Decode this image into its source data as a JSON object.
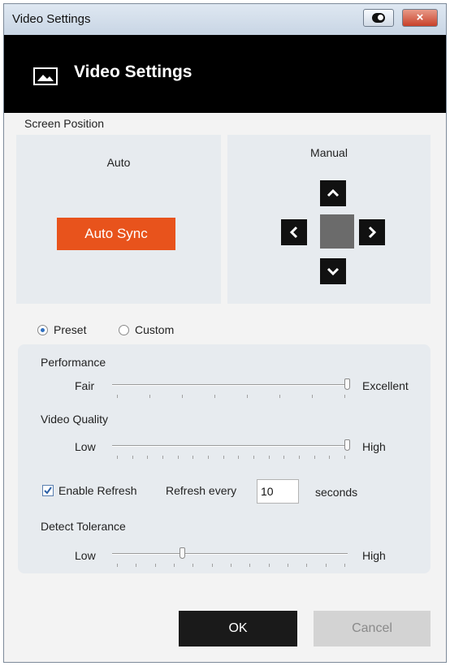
{
  "window": {
    "title": "Video Settings",
    "close_glyph": "×",
    "toggle_icon": "mode-toggle-icon"
  },
  "header": {
    "title": "Video Settings",
    "icon": "image-icon"
  },
  "screen_position": {
    "label": "Screen Position",
    "auto": {
      "title": "Auto",
      "button": "Auto Sync",
      "button_color": "#e8531c"
    },
    "manual": {
      "title": "Manual"
    }
  },
  "mode": {
    "selected": "Preset",
    "options": [
      "Preset",
      "Custom"
    ]
  },
  "performance": {
    "label": "Performance",
    "min": "Fair",
    "max": "Excellent",
    "level": 1.0
  },
  "video_quality": {
    "label": "Video Quality",
    "min": "Low",
    "max": "High",
    "level": 1.0
  },
  "refresh": {
    "checkbox_label": "Enable Refresh",
    "checked": true,
    "every_label": "Refresh every",
    "value": "10",
    "unit": "seconds"
  },
  "detect_tolerance": {
    "label": "Detect Tolerance",
    "min": "Low",
    "max": "High",
    "level": 0.3
  },
  "buttons": {
    "ok": "OK",
    "cancel": "Cancel"
  }
}
